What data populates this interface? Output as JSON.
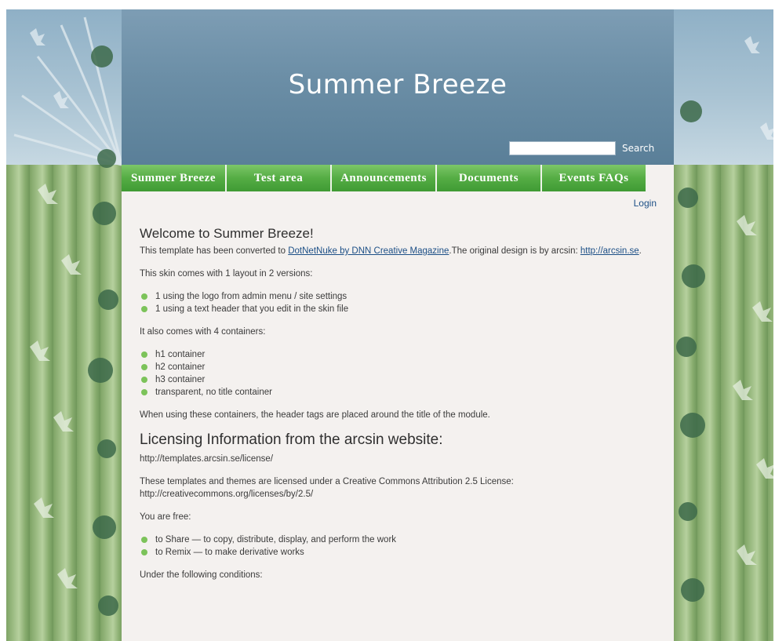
{
  "site": {
    "title": "Summer Breeze",
    "search_label": "Search",
    "search_value": "",
    "login_label": "Login"
  },
  "nav": {
    "items": [
      {
        "label": "Summer Breeze"
      },
      {
        "label": "Test area"
      },
      {
        "label": "Announcements"
      },
      {
        "label": "Documents"
      },
      {
        "label": "Events FAQs"
      }
    ]
  },
  "content": {
    "welcome_heading": "Welcome to Summer Breeze!",
    "intro_before_link": "This template has been converted to ",
    "intro_link": "DotNetNuke by DNN Creative Magazine",
    "intro_after_link": ".The original design is by arcsin: ",
    "arcsin_link": "http://arcsin.se",
    "intro_end": ".",
    "layout_text": "This skin comes with 1 layout in 2 versions:",
    "layout_items": [
      "1 using the logo from admin menu / site settings",
      "1 using a text header that you edit in the skin file"
    ],
    "containers_text": "It also comes with 4 containers:",
    "container_items": [
      "h1 container",
      "h2 container",
      "h3 container",
      "transparent, no title container"
    ],
    "containers_note": "When using these containers, the header tags are placed around the title of the module.",
    "licensing_heading": "Licensing Information from the arcsin website:",
    "license_url": "http://templates.arcsin.se/license/",
    "license_text_1": "These templates and themes are licensed under a Creative Commons Attribution 2.5 License:",
    "license_text_2": "http://creativecommons.org/licenses/by/2.5/",
    "free_text": "You are free:",
    "free_items": [
      "to Share — to copy, distribute, display, and perform the work",
      "to Remix — to make derivative works"
    ],
    "conditions_text": "Under the following conditions:"
  },
  "colors": {
    "header_blue": "#6b8ea6",
    "nav_green": "#55ad44",
    "content_bg": "#f4f1ef",
    "link_blue": "#1c4f86",
    "bullet_green": "#7cc35a"
  }
}
